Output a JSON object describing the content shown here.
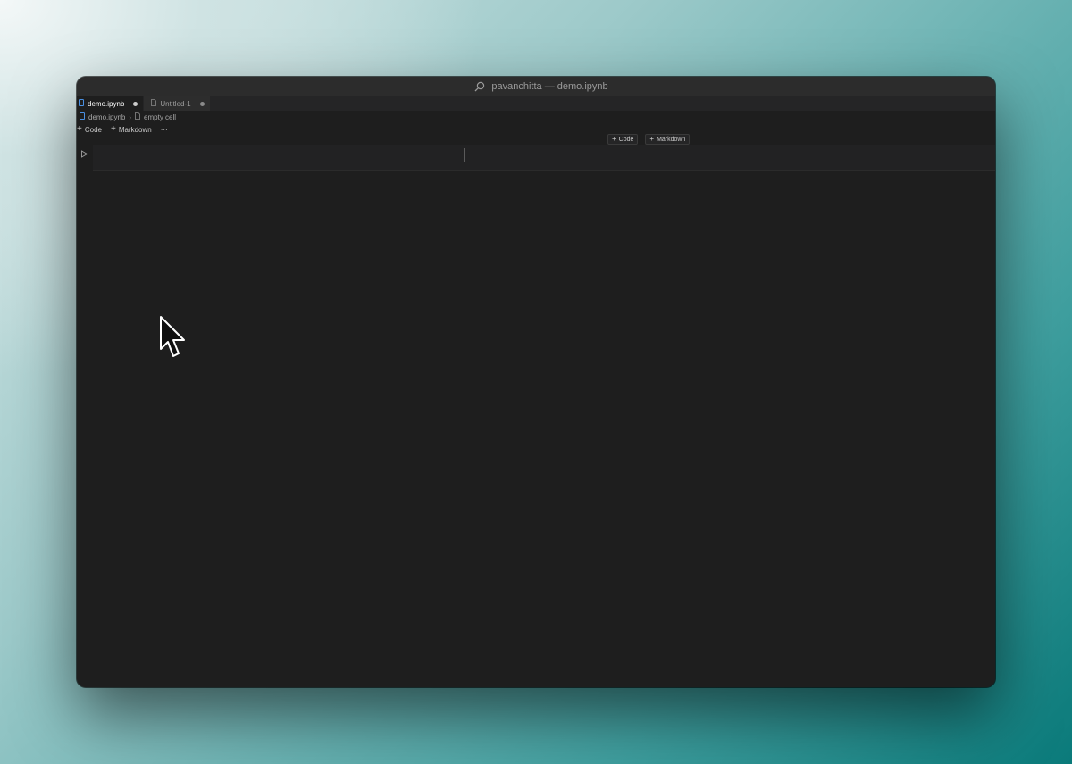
{
  "window": {
    "title": "pavanchitta — demo.ipynb"
  },
  "tabs": [
    {
      "label": "demo.ipynb",
      "active": true,
      "unsaved": true,
      "icon": "notebook-icon"
    },
    {
      "label": "Untitled-1",
      "active": false,
      "unsaved": true,
      "icon": "file-icon"
    }
  ],
  "breadcrumb": {
    "file": "demo.ipynb",
    "cell": "empty cell"
  },
  "toolbar": {
    "code_label": "Code",
    "markdown_label": "Markdown",
    "more_label": "···"
  },
  "insert": {
    "code_label": "Code",
    "markdown_label": "Markdown"
  },
  "colors": {
    "editor_bg": "#1e1e1e",
    "tab_active_bg": "#1e1e1e",
    "tab_inactive_bg": "#2d2d2d",
    "titlebar_bg": "#2c2c2c",
    "notebook_icon": "#4a90e2"
  }
}
